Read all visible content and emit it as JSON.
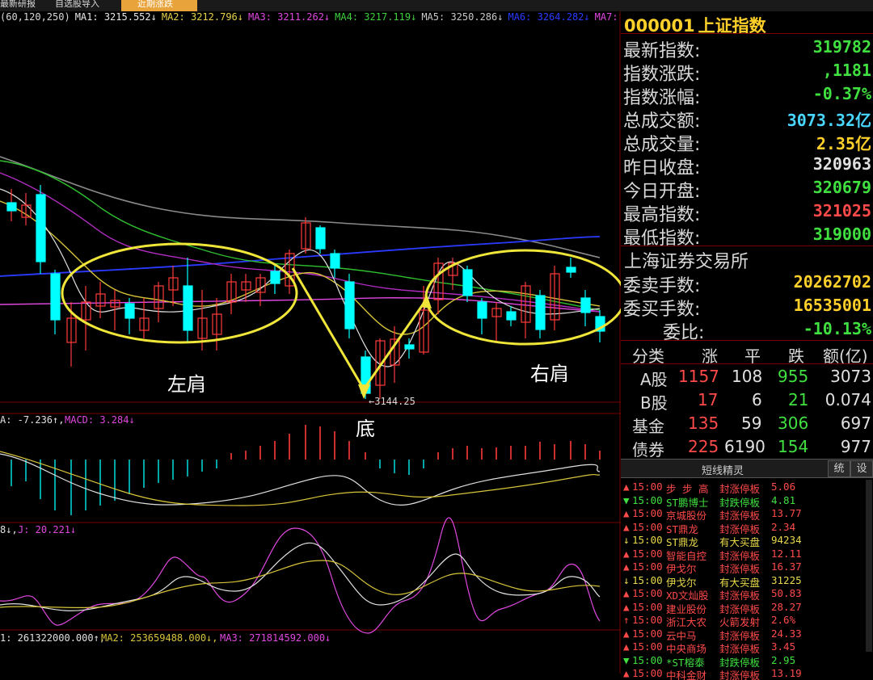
{
  "topbar": {
    "tabs": [
      {
        "label": "最新研报",
        "active": false
      },
      {
        "label": "自选股导入",
        "active": false
      },
      {
        "label": "近期涨跌",
        "active": false
      }
    ]
  },
  "ma_line": [
    {
      "text": "(60,120,250)",
      "color": "#d9d9d9"
    },
    {
      "text": "MA1: 3215.552↓",
      "color": "#e8e8e8"
    },
    {
      "text": "MA2: 3212.796↓",
      "color": "#e6d24a"
    },
    {
      "text": "MA3: 3211.262↓",
      "color": "#e048e0"
    },
    {
      "text": "MA4: 3217.119↓",
      "color": "#3fcf3f"
    },
    {
      "text": "MA5: 3250.286↓",
      "color": "#c9c9c9"
    },
    {
      "text": "MA6: 3264.282↓",
      "color": "#2a3aff"
    },
    {
      "text": "MA7:",
      "color": "#e048e0"
    }
  ],
  "annotations": {
    "left_shoulder": "左肩",
    "right_shoulder": "右肩",
    "bottom": "底",
    "low_price": "←3144.25"
  },
  "macd_line": {
    "text1": "A: -7.236↑,",
    "text2": "MACD: 3.284↓"
  },
  "kdj_line": {
    "text1": "8↓,",
    "text2": "J: 20.221↓"
  },
  "vol_line": {
    "text1": "1: 261322000.000↑,",
    "text2": "MA2: 253659488.000↓,",
    "text3": "MA3: 271814592.000↓"
  },
  "quote": {
    "code": "000001",
    "name": "上证指数",
    "rows": [
      {
        "label": "最新指数:",
        "value": "319782",
        "color": "#3fe03f"
      },
      {
        "label": "指数涨跌:",
        "value": ",1181",
        "color": "#3fe03f"
      },
      {
        "label": "指数涨幅:",
        "value": "-0.37%",
        "color": "#3fe03f"
      },
      {
        "label": "总成交额:",
        "value": "3073.32亿",
        "color": "#49d6ff"
      },
      {
        "label": "总成交量:",
        "value": "2.35亿",
        "color": "#ffd02a"
      },
      {
        "label": "昨日收盘:",
        "value": "320963",
        "color": "#e0e0e0"
      },
      {
        "label": "今日开盘:",
        "value": "320679",
        "color": "#3fe03f"
      },
      {
        "label": "最高指数:",
        "value": "321025",
        "color": "#ff4a4a"
      },
      {
        "label": "最低指数:",
        "value": "319000",
        "color": "#3fe03f"
      }
    ],
    "exchange": "上海证券交易所",
    "rows2": [
      {
        "label": "委卖手数:",
        "value": "20262702",
        "color": "#ffd02a"
      },
      {
        "label": "委买手数:",
        "value": "16535001",
        "color": "#ffd02a"
      },
      {
        "label": "委比:",
        "value": "-10.13%",
        "color": "#3fe03f"
      }
    ],
    "table_head": [
      "分类",
      "涨",
      "平",
      "跌",
      "额(亿)"
    ],
    "table_rows": [
      {
        "cat": "A股",
        "up": "1157",
        "flat": "108",
        "down": "955",
        "amt": "3073"
      },
      {
        "cat": "B股",
        "up": "17",
        "flat": "6",
        "down": "21",
        "amt": "0.074"
      },
      {
        "cat": "基金",
        "up": "135",
        "flat": "59",
        "down": "306",
        "amt": "697"
      },
      {
        "cat": "债券",
        "up": "225",
        "flat": "6190",
        "down": "154",
        "amt": "977"
      }
    ]
  },
  "short_line": {
    "title": "短线精灵",
    "btn1": "统",
    "btn2": "设",
    "items": [
      {
        "mark": "▲",
        "time": "15:00",
        "name": "步 步 高",
        "event": "封涨停板",
        "val": "5.06",
        "color": "#ff4a4a"
      },
      {
        "mark": "▼",
        "time": "15:00",
        "name": "ST鹏博士",
        "event": "封跌停板",
        "val": "4.81",
        "color": "#3fe03f"
      },
      {
        "mark": "▲",
        "time": "15:00",
        "name": "京城股份",
        "event": "封涨停板",
        "val": "13.77",
        "color": "#ff4a4a"
      },
      {
        "mark": "▲",
        "time": "15:00",
        "name": "ST鼎龙",
        "event": "封涨停板",
        "val": "2.34",
        "color": "#ff4a4a"
      },
      {
        "mark": "↓",
        "time": "15:00",
        "name": "ST鼎龙",
        "event": "有大买盘",
        "val": "94234",
        "color": "#e8d84a"
      },
      {
        "mark": "▲",
        "time": "15:00",
        "name": "智能自控",
        "event": "封涨停板",
        "val": "12.11",
        "color": "#ff4a4a"
      },
      {
        "mark": "▲",
        "time": "15:00",
        "name": "伊戈尔",
        "event": "封涨停板",
        "val": "16.37",
        "color": "#ff4a4a"
      },
      {
        "mark": "↓",
        "time": "15:00",
        "name": "伊戈尔",
        "event": "有大买盘",
        "val": "31225",
        "color": "#e8d84a"
      },
      {
        "mark": "▲",
        "time": "15:00",
        "name": "XD文灿股",
        "event": "封涨停板",
        "val": "50.83",
        "color": "#ff4a4a"
      },
      {
        "mark": "▲",
        "time": "15:00",
        "name": "建业股份",
        "event": "封涨停板",
        "val": "28.27",
        "color": "#ff4a4a"
      },
      {
        "mark": "↑",
        "time": "15:00",
        "name": "浙江大农",
        "event": "火箭发射",
        "val": "2.6%",
        "color": "#ff4a4a"
      },
      {
        "mark": "▲",
        "time": "15:00",
        "name": "云中马",
        "event": "封涨停板",
        "val": "24.33",
        "color": "#ff4a4a"
      },
      {
        "mark": "▲",
        "time": "15:00",
        "name": "中央商场",
        "event": "封涨停板",
        "val": "3.45",
        "color": "#ff4a4a"
      },
      {
        "mark": "▼",
        "time": "15:00",
        "name": "*ST榕泰",
        "event": "封跌停板",
        "val": "2.95",
        "color": "#3fe03f"
      },
      {
        "mark": "▲",
        "time": "15:00",
        "name": "中科金财",
        "event": "封涨停板",
        "val": "13.19",
        "color": "#ff4a4a"
      }
    ]
  }
}
